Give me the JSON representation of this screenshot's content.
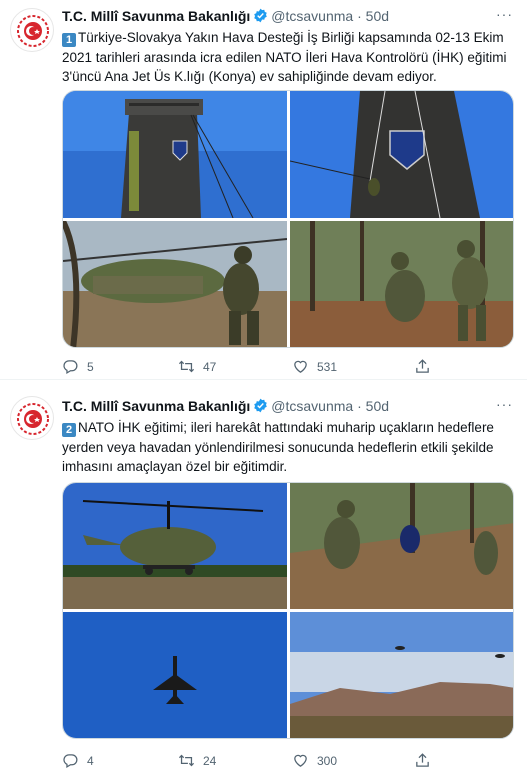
{
  "tweets": [
    {
      "author": {
        "name": "T.C. Millî Savunma Bakanlığı",
        "handle": "@tcsavunma",
        "time": "50d"
      },
      "keycap": "1",
      "text": "Türkiye-Slovakya Yakın Hava Desteği İş Birliği kapsamında 02-13 Ekim 2021 tarihleri arasında icra edilen NATO İleri Hava Kontrolörü (İHK) eğitimi 3'üncü Ana Jet Üs K.lığı (Konya) ev sahipliğinde devam ediyor.",
      "images": [
        "tower-with-emblem",
        "rappelling-from-tower",
        "soldier-by-helicopter",
        "soldiers-in-forest"
      ],
      "stats": {
        "replies": "5",
        "retweets": "47",
        "likes": "531"
      }
    },
    {
      "author": {
        "name": "T.C. Millî Savunma Bakanlığı",
        "handle": "@tcsavunma",
        "time": "50d"
      },
      "keycap": "2",
      "text": "NATO İHK eğitimi; ileri harekât hattındaki muharip uçakların hedeflere yerden veya havadan yönlendirilmesi sonucunda hedeflerin etkili şekilde imhasını amaçlayan özel bir eğitimdir.",
      "images": [
        "helicopter-landing",
        "soldiers-on-hillside",
        "fighter-jet-in-sky",
        "aircraft-over-mountains"
      ],
      "stats": {
        "replies": "4",
        "retweets": "24",
        "likes": "300"
      }
    }
  ],
  "colors": {
    "verified": "#1d9bf0",
    "keycap": "#3b88c3",
    "muted": "#536471"
  }
}
